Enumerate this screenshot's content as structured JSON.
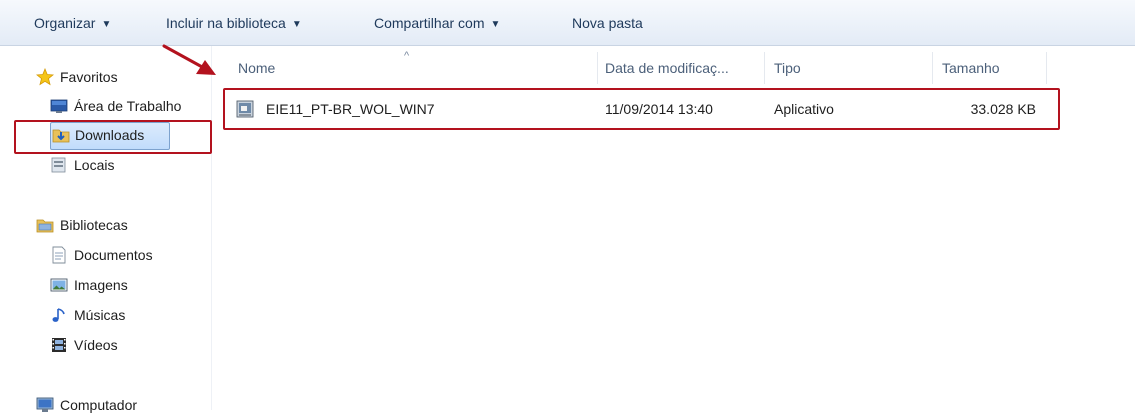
{
  "toolbar": {
    "organize": "Organizar",
    "include_library": "Incluir na biblioteca",
    "share_with": "Compartilhar com",
    "new_folder": "Nova pasta",
    "caret": "▼"
  },
  "nav": {
    "favorites": "Favoritos",
    "desktop": "Área de Trabalho",
    "downloads": "Downloads",
    "places": "Locais",
    "libraries": "Bibliotecas",
    "documents": "Documentos",
    "images": "Imagens",
    "music": "Músicas",
    "videos": "Vídeos",
    "computer": "Computador"
  },
  "columns": {
    "name": "Nome",
    "date": "Data de modificaç...",
    "type": "Tipo",
    "size": "Tamanho",
    "sort_indicator": "^"
  },
  "files": [
    {
      "name": "EIE11_PT-BR_WOL_WIN7",
      "date": "11/09/2014 13:40",
      "type": "Aplicativo",
      "size": "33.028 KB"
    }
  ],
  "colors": {
    "highlight": "#b3121e",
    "toolbar_text": "#1e395b",
    "header_text": "#4c607a",
    "selected_bg": "#c1dcfc"
  }
}
